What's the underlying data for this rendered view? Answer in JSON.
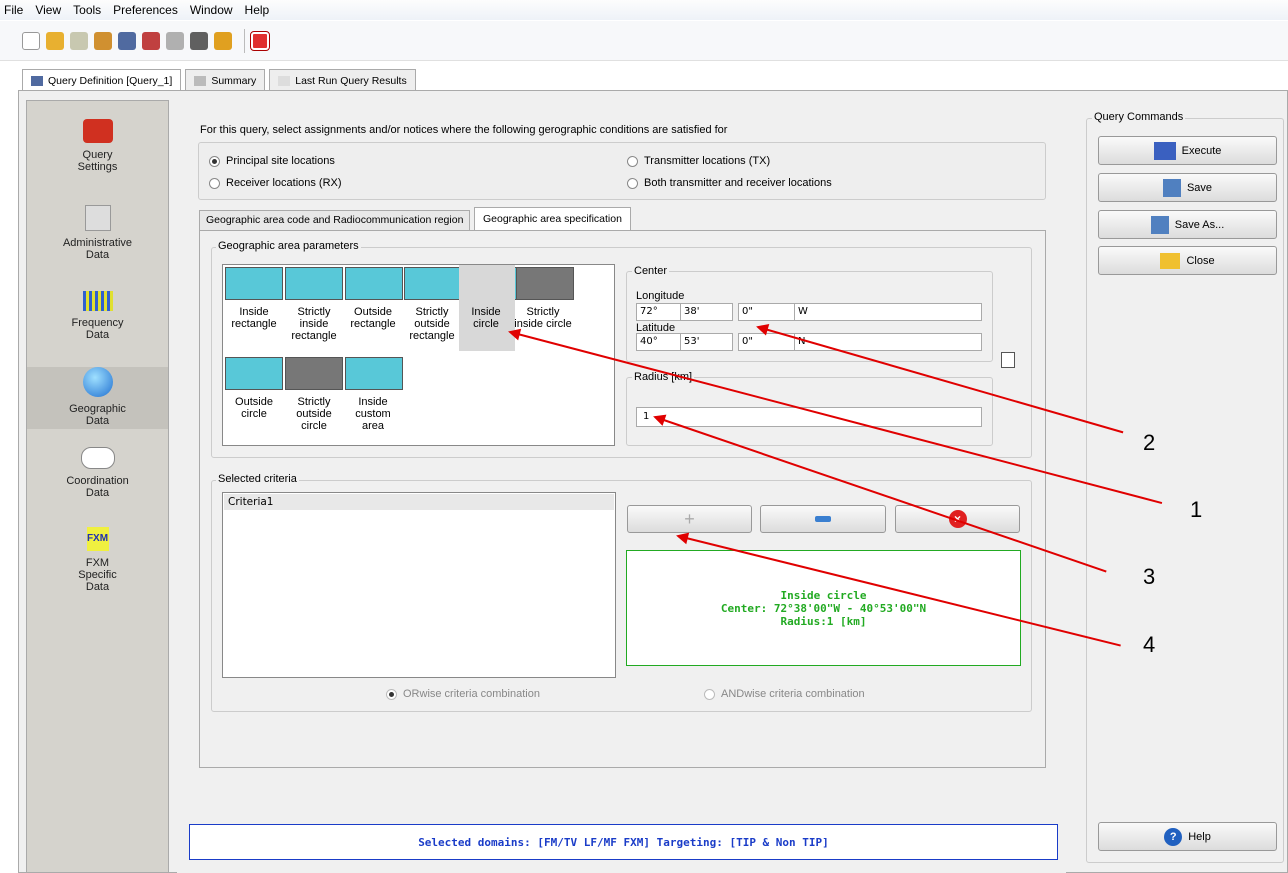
{
  "menu": [
    "File",
    "View",
    "Tools",
    "Preferences",
    "Window",
    "Help"
  ],
  "tabs": [
    "Query Definition [Query_1]",
    "Summary",
    "Last Run Query Results"
  ],
  "sidebar": [
    {
      "label": "Query Settings",
      "icon": "toolbox-icon"
    },
    {
      "label": "Administrative Data",
      "icon": "calendar-pen-icon"
    },
    {
      "label": "Frequency Data",
      "icon": "spectrum-icon"
    },
    {
      "label": "Geographic Data",
      "icon": "globe-icon"
    },
    {
      "label": "Coordination Data",
      "icon": "handshake-icon"
    },
    {
      "label": "FXM Specific Data",
      "icon": "fxm-logo-icon"
    }
  ],
  "fxm_logo": "FXM",
  "intro": "For this query, select assignments and/or notices where the following gerographic conditions are satisfied for",
  "locations": {
    "principal": "Principal site locations",
    "rx": "Receiver locations (RX)",
    "tx": "Transmitter locations (TX)",
    "both": "Both transmitter and receiver locations"
  },
  "subtabs": [
    "Geographic area code and Radiocommunication region",
    "Geographic area specification"
  ],
  "geo_params_title": "Geographic area parameters",
  "shapes": [
    "Inside rectangle",
    "Strictly inside rectangle",
    "Outside rectangle",
    "Strictly outside rectangle",
    "Inside circle",
    "Strictly inside circle",
    "Outside circle",
    "Strictly outside circle",
    "Inside custom area"
  ],
  "center": {
    "title": "Center",
    "lon_label": "Longitude",
    "lon_deg": "72°",
    "lon_min": "38'",
    "lon_sec": "0\"",
    "lon_dir": "W",
    "lat_label": "Latitude",
    "lat_deg": "40°",
    "lat_min": "53'",
    "lat_sec": "0\"",
    "lat_dir": "N"
  },
  "radius": {
    "title": "Radius [km]",
    "value": "1"
  },
  "selected_criteria_title": "Selected criteria",
  "criteria_list": [
    "Criteria1"
  ],
  "criteria_summary": {
    "line1": "Inside circle",
    "line2": "Center: 72°38'00\"W - 40°53'00\"N",
    "line3": "Radius:1 [km]"
  },
  "combination": {
    "orwise": "ORwise criteria combination",
    "andwise": "ANDwise criteria combination"
  },
  "status": "Selected domains: [FM/TV  LF/MF  FXM]   Targeting: [TIP  &  Non TIP]",
  "commands": {
    "title": "Query Commands",
    "execute": "Execute",
    "save": "Save",
    "save_as": "Save As...",
    "close": "Close",
    "help": "Help"
  },
  "callouts": [
    "2",
    "1",
    "3",
    "4"
  ],
  "colors": {
    "arrow": "#e00000",
    "summary": "#22aa22",
    "status_text": "#1a3cc8",
    "shape_fill": "#58c8d8"
  }
}
